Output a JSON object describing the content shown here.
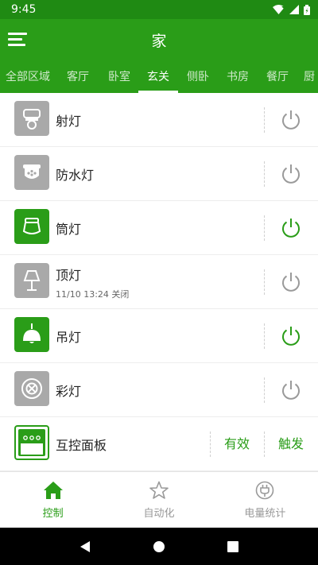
{
  "status_bar": {
    "time": "9:45"
  },
  "app_bar": {
    "title": "家"
  },
  "tabs": [
    {
      "label": "全部区域"
    },
    {
      "label": "客厅"
    },
    {
      "label": "卧室"
    },
    {
      "label": "玄关",
      "active": true
    },
    {
      "label": "侧卧"
    },
    {
      "label": "书房"
    },
    {
      "label": "餐厅"
    },
    {
      "label": "厨"
    }
  ],
  "devices": [
    {
      "name": "射灯",
      "icon": "spotlight-icon",
      "on": false
    },
    {
      "name": "防水灯",
      "icon": "waterproof-light-icon",
      "on": false
    },
    {
      "name": "筒灯",
      "icon": "downlight-icon",
      "on": true
    },
    {
      "name": "顶灯",
      "icon": "table-lamp-icon",
      "on": false,
      "subtitle": "11/10 13:24 关闭"
    },
    {
      "name": "吊灯",
      "icon": "pendant-lamp-icon",
      "on": true
    },
    {
      "name": "彩灯",
      "icon": "color-light-icon",
      "on": false
    }
  ],
  "panel": {
    "name": "互控面板",
    "icon": "control-panel-icon",
    "action_valid": "有效",
    "action_trigger": "触发"
  },
  "bottom_nav": [
    {
      "label": "控制",
      "icon": "home-icon",
      "active": true
    },
    {
      "label": "自动化",
      "icon": "star-icon",
      "active": false
    },
    {
      "label": "电量统计",
      "icon": "plug-icon",
      "active": false
    }
  ],
  "colors": {
    "accent": "#2a9d18",
    "status_bar": "#1f8a13",
    "off_gray": "#a9a9a9"
  }
}
